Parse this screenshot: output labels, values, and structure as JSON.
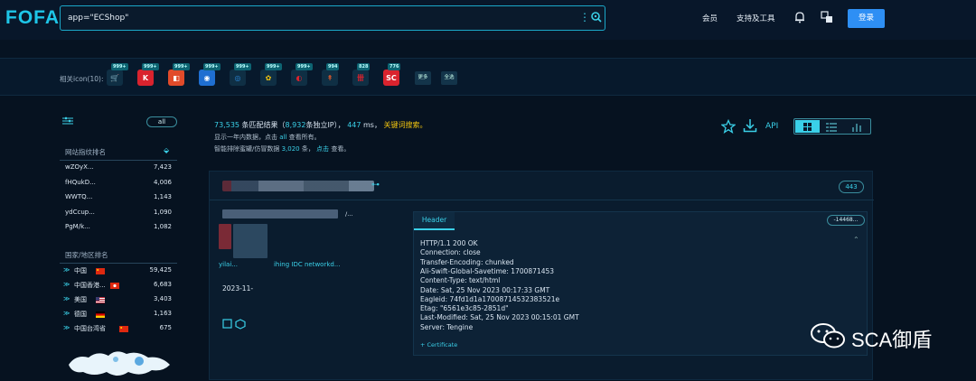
{
  "logo": "FOFA",
  "search": {
    "query": "app=\"ECShop\""
  },
  "nav": {
    "member": "会员",
    "support": "支持及工具",
    "login": "登录"
  },
  "related": {
    "label": "相关icon(10):",
    "icons": [
      {
        "badge": "999+",
        "bg": "#0f2f44",
        "fg": "#e05a2b",
        "glyph": "🛒"
      },
      {
        "badge": "999+",
        "bg": "#d9232e",
        "fg": "#ffffff",
        "glyph": "K"
      },
      {
        "badge": "999+",
        "bg": "#e14b2a",
        "fg": "#ffffff",
        "glyph": "◧"
      },
      {
        "badge": "999+",
        "bg": "#1f6fd1",
        "fg": "#ffffff",
        "glyph": "◉"
      },
      {
        "badge": "999+",
        "bg": "#0f2f44",
        "fg": "#2a86d8",
        "glyph": "◎"
      },
      {
        "badge": "999+",
        "bg": "#0f2f44",
        "fg": "#f1c40f",
        "glyph": "✿"
      },
      {
        "badge": "999+",
        "bg": "#0f2f44",
        "fg": "#d9232e",
        "glyph": "◐"
      },
      {
        "badge": "994",
        "bg": "#0f2f44",
        "fg": "#e05a2b",
        "glyph": "↟"
      },
      {
        "badge": "828",
        "bg": "#0f2f44",
        "fg": "#d9232e",
        "glyph": "卌"
      },
      {
        "badge": "776",
        "bg": "#d9232e",
        "fg": "#ffffff",
        "glyph": "SC"
      }
    ],
    "more": "更多",
    "all": "全选"
  },
  "sidebar": {
    "all": "all",
    "site_title": "网站指纹排名",
    "sites": [
      {
        "name": "wZOyX...",
        "count": "7,423"
      },
      {
        "name": "fHQukD...",
        "count": "4,006"
      },
      {
        "name": "WWTQ...",
        "count": "1,143"
      },
      {
        "name": "ydCcup...",
        "count": "1,090"
      },
      {
        "name": "PgM/k...",
        "count": "1,082"
      }
    ],
    "country_title": "国家/地区排名",
    "countries": [
      {
        "name": "中国",
        "count": "59,425",
        "flag": "cn"
      },
      {
        "name": "中国香港...",
        "count": "6,683",
        "flag": "hk"
      },
      {
        "name": "美国",
        "count": "3,403",
        "flag": "us"
      },
      {
        "name": "德国",
        "count": "1,163",
        "flag": "de"
      },
      {
        "name": "中国台湾省",
        "count": "675",
        "flag": "cn"
      }
    ]
  },
  "stats": {
    "count": "73,535",
    "t1": "条匹配结果（",
    "ips": "8,932",
    "t2": "条独立IP），",
    "ms": "447",
    "t3": "ms，",
    "kw": "关键词搜索。",
    "line2_a": "显示一年内数据，点击",
    "line2_all": "all",
    "line2_b": "查看所有。",
    "line3_a": "智能排除蜜罐/仿冒数据",
    "line3_num": "3,020",
    "line3_b": "条，",
    "line3_click": "点击",
    "line3_c": "查看。"
  },
  "toolbar": {
    "api": "API"
  },
  "result": {
    "port": "443",
    "url_tail": "/...",
    "link_tail": "ihing IDC networkd...",
    "link_head": "yilai...",
    "date": "2023-11-",
    "header_tab": "Header",
    "hash": "-14468...",
    "header_lines": [
      "HTTP/1.1 200 OK",
      "Connection: close",
      "Transfer-Encoding: chunked",
      "Ali-Swift-Global-Savetime: 1700871453",
      "Content-Type: text/html",
      "Date: Sat, 25 Nov 2023 00:17:33 GMT",
      "Eagleid: 74fd1d1a17008714532383521e",
      "Etag: \"6561e3c85-2851d\"",
      "Last-Modified: Sat, 25 Nov 2023 00:15:01 GMT",
      "Server: Tengine"
    ],
    "cert": "+ Certificate"
  },
  "watermark": "SCA御盾"
}
